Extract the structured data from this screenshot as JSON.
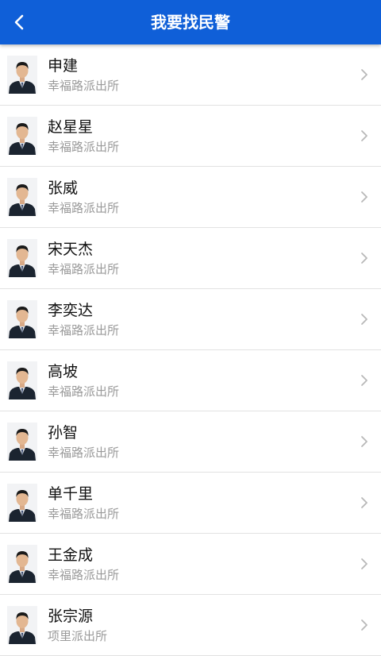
{
  "header": {
    "title": "我要找民警",
    "back_icon": "chevron-left-icon"
  },
  "colors": {
    "header_bg": "#0f5fd8",
    "name": "#111111",
    "subtitle": "#9a9a9a",
    "divider": "#e2e2e2"
  },
  "officers": [
    {
      "name": "申建",
      "station": "幸福路派出所"
    },
    {
      "name": "赵星星",
      "station": "幸福路派出所"
    },
    {
      "name": "张威",
      "station": "幸福路派出所"
    },
    {
      "name": "宋天杰",
      "station": "幸福路派出所"
    },
    {
      "name": "李奕达",
      "station": "幸福路派出所"
    },
    {
      "name": "高坡",
      "station": "幸福路派出所"
    },
    {
      "name": "孙智",
      "station": "幸福路派出所"
    },
    {
      "name": "单千里",
      "station": "幸福路派出所"
    },
    {
      "name": "王金成",
      "station": "幸福路派出所"
    },
    {
      "name": "张宗源",
      "station": "项里派出所"
    }
  ]
}
